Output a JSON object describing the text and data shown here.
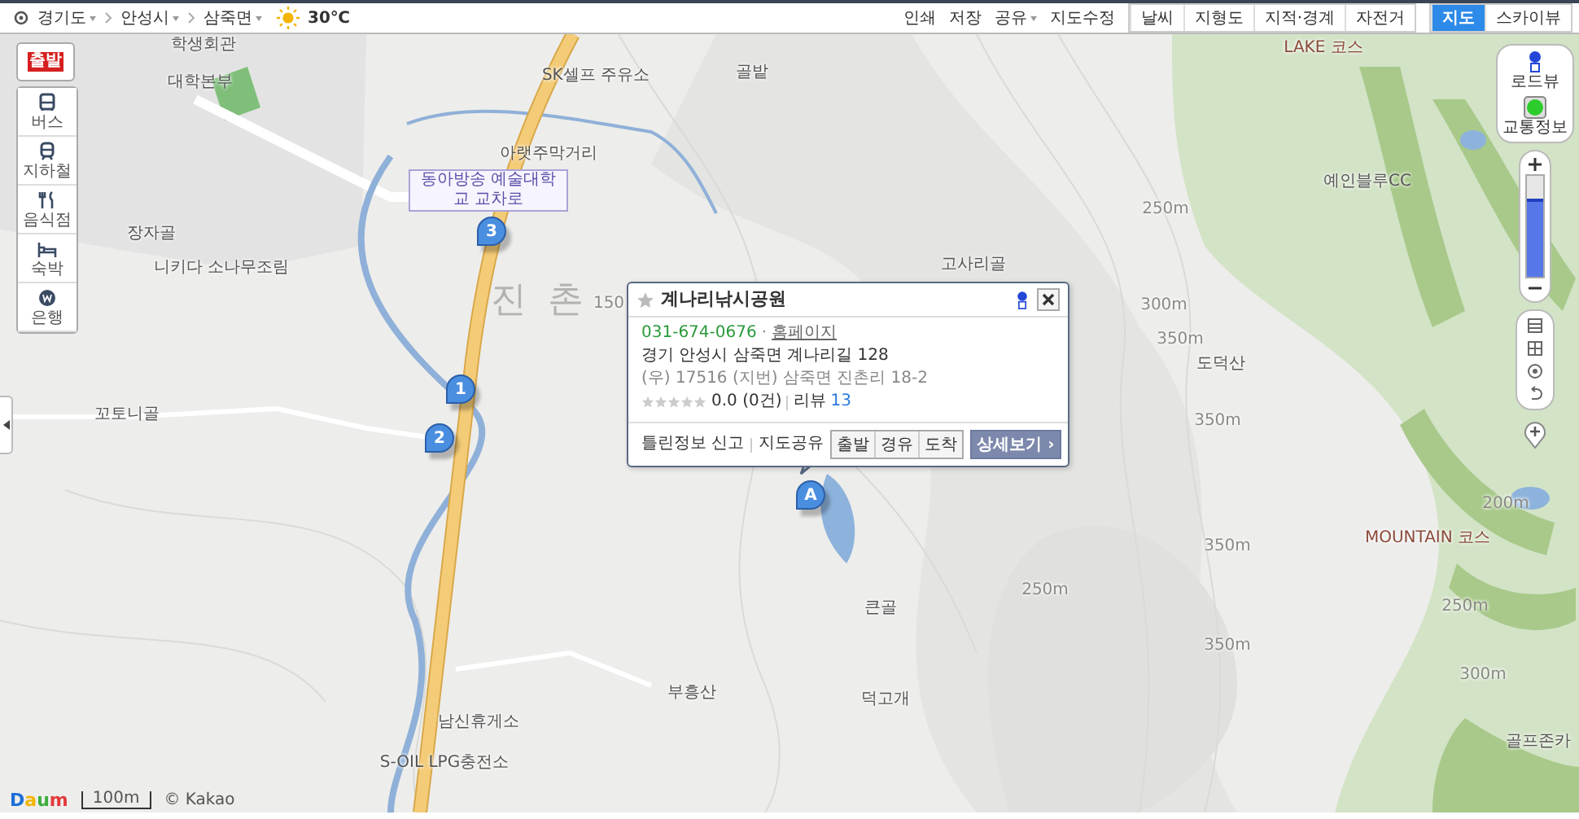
{
  "location_bar": {
    "breadcrumbs": [
      "경기도",
      "안성시",
      "삼죽면"
    ],
    "weather": "30℃"
  },
  "toolbar": {
    "links": [
      {
        "label": "인쇄",
        "dropdown": false
      },
      {
        "label": "저장",
        "dropdown": false
      },
      {
        "label": "공유",
        "dropdown": true
      },
      {
        "label": "지도수정",
        "dropdown": false
      }
    ],
    "layers": [
      {
        "label": "날씨",
        "selected": false
      },
      {
        "label": "지형도",
        "selected": false
      },
      {
        "label": "지적·경계",
        "selected": false
      },
      {
        "label": "자전거",
        "selected": false
      }
    ],
    "map_types": [
      {
        "label": "지도",
        "selected": true
      },
      {
        "label": "스카이뷰",
        "selected": false
      }
    ]
  },
  "left_tools": [
    {
      "label": "출발",
      "kind": "start"
    },
    {
      "label": "버스",
      "kind": "bus"
    },
    {
      "label": "지하철",
      "kind": "subway"
    },
    {
      "label": "음식점",
      "kind": "food"
    },
    {
      "label": "숙박",
      "kind": "bed"
    },
    {
      "label": "은행",
      "kind": "bank"
    }
  ],
  "right_tools": {
    "roadview": "로드뷰",
    "traffic": {
      "label": "교통정보",
      "on": true
    },
    "zoom": {
      "level": 0.78
    }
  },
  "map_labels": [
    {
      "text": "학생회관",
      "kind": "place"
    },
    {
      "text": "대학본부",
      "kind": "place"
    },
    {
      "text": "SK셀프 주유소",
      "kind": "place"
    },
    {
      "text": "골밭",
      "kind": "place"
    },
    {
      "text": "아랫주막거리",
      "kind": "place"
    },
    {
      "text": "동아방송 예술대학교 교차로",
      "kind": "sign"
    },
    {
      "text": "장자골",
      "kind": "place"
    },
    {
      "text": "니키다 소나무조림",
      "kind": "place"
    },
    {
      "text": "진 촌",
      "kind": "area"
    },
    {
      "text": "150",
      "kind": "elevation"
    },
    {
      "text": "고사리골",
      "kind": "place"
    },
    {
      "text": "250m",
      "kind": "elevation"
    },
    {
      "text": "300m",
      "kind": "elevation"
    },
    {
      "text": "LAKE 코스",
      "kind": "course"
    },
    {
      "text": "예인블루CC",
      "kind": "place"
    },
    {
      "text": "꼬토니골",
      "kind": "place"
    },
    {
      "text": "350m",
      "kind": "elevation"
    },
    {
      "text": "도덕산",
      "kind": "place"
    },
    {
      "text": "350m",
      "kind": "elevation"
    },
    {
      "text": "350m",
      "kind": "elevation"
    },
    {
      "text": "250m",
      "kind": "elevation"
    },
    {
      "text": "350m",
      "kind": "elevation"
    },
    {
      "text": "200m",
      "kind": "elevation"
    },
    {
      "text": "MOUNTAIN 코스",
      "kind": "course"
    },
    {
      "text": "250m",
      "kind": "elevation"
    },
    {
      "text": "300m",
      "kind": "elevation"
    },
    {
      "text": "큰골",
      "kind": "place"
    },
    {
      "text": "덕고개",
      "kind": "place"
    },
    {
      "text": "부흥산",
      "kind": "place"
    },
    {
      "text": "남신휴게소",
      "kind": "place"
    },
    {
      "text": "S-OIL LPG충전소",
      "kind": "place"
    },
    {
      "text": "골프존카",
      "kind": "place"
    }
  ],
  "markers": [
    "3",
    "1",
    "2",
    "A"
  ],
  "popup": {
    "title": "계나리낚시공원",
    "phone": "031-674-0676",
    "separator": "·",
    "homepage": "홈페이지",
    "address": "경기 안성시 삼죽면 계나리길 128",
    "address_detail": "(우) 17516 (지번) 삼죽면 진촌리 18-2",
    "stars": 0,
    "rating": "0.0 (0건)",
    "review_label": "리뷰",
    "review_count": "13",
    "report": "틀린정보 신고",
    "share": "지도공유",
    "route_buttons": [
      "출발",
      "경유",
      "도착"
    ],
    "detail_button": "상세보기 ›"
  },
  "footer": {
    "logo": "Daum",
    "scale": "100m",
    "copyright": "© Kakao"
  }
}
